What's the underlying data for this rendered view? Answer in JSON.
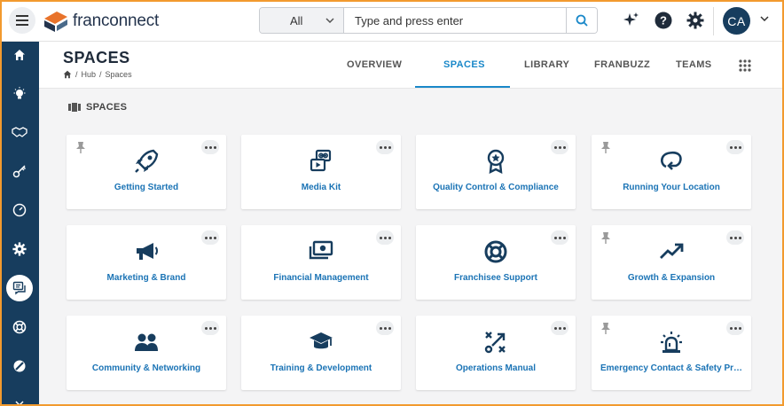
{
  "app": {
    "logo_text": "franconnect"
  },
  "search": {
    "scope": "All",
    "placeholder": "Type and press enter"
  },
  "user": {
    "initials": "CA"
  },
  "page": {
    "title": "SPACES",
    "breadcrumb": [
      "Hub",
      "Spaces"
    ]
  },
  "tabs": [
    {
      "label": "OVERVIEW",
      "active": false
    },
    {
      "label": "SPACES",
      "active": true
    },
    {
      "label": "LIBRARY",
      "active": false
    },
    {
      "label": "FRANBUZZ",
      "active": false
    },
    {
      "label": "TEAMS",
      "active": false
    }
  ],
  "section": {
    "label": "SPACES"
  },
  "cards": [
    {
      "label": "Getting Started",
      "icon": "rocket-icon",
      "pinned": true
    },
    {
      "label": "Media Kit",
      "icon": "media-kit-icon",
      "pinned": false
    },
    {
      "label": "Quality Control & Compliance",
      "icon": "award-icon",
      "pinned": false
    },
    {
      "label": "Running Your Location",
      "icon": "loop-arrow-icon",
      "pinned": true
    },
    {
      "label": "Marketing & Brand",
      "icon": "megaphone-icon",
      "pinned": false
    },
    {
      "label": "Financial Management",
      "icon": "money-icon",
      "pinned": false
    },
    {
      "label": "Franchisee Support",
      "icon": "lifebuoy-icon",
      "pinned": false
    },
    {
      "label": "Growth & Expansion",
      "icon": "trend-up-icon",
      "pinned": true
    },
    {
      "label": "Community & Networking",
      "icon": "people-icon",
      "pinned": false
    },
    {
      "label": "Training & Development",
      "icon": "graduation-cap-icon",
      "pinned": false
    },
    {
      "label": "Operations Manual",
      "icon": "strategy-icon",
      "pinned": false
    },
    {
      "label": "Emergency Contact & Safety Pr…",
      "icon": "alarm-light-icon",
      "pinned": true
    }
  ],
  "colors": {
    "primary": "#173d5e",
    "accent": "#1a88c9",
    "link": "#1a73b5",
    "frame": "#f29a2e",
    "logo_orange": "#e8732b"
  }
}
